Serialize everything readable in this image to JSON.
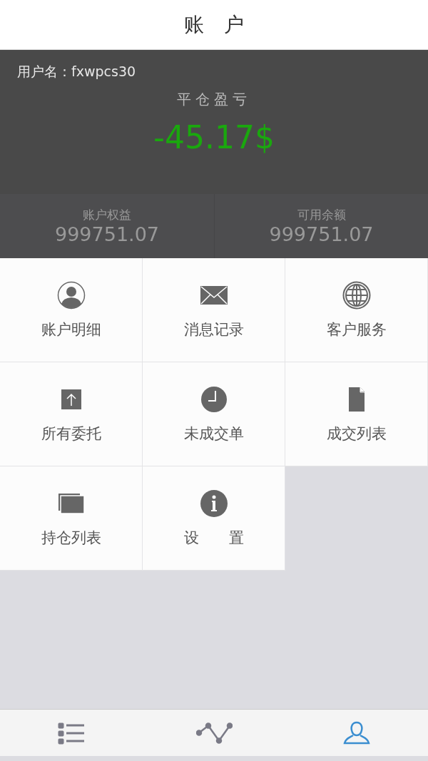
{
  "nav_bar": {
    "title": "账　户"
  },
  "summary": {
    "username_label": "用户名：",
    "username": "fxwpcs30",
    "pnl_label": "平仓盈亏",
    "pnl_value": "-45.17$"
  },
  "stats": [
    {
      "label": "账户权益",
      "value": "999751.07"
    },
    {
      "label": "可用余额",
      "value": "999751.07"
    }
  ],
  "menu": [
    {
      "label": "账户明细"
    },
    {
      "label": "消息记录"
    },
    {
      "label": "客户服务"
    },
    {
      "label": "所有委托"
    },
    {
      "label": "未成交单"
    },
    {
      "label": "成交列表"
    },
    {
      "label": "持仓列表"
    },
    {
      "label": "设　　置"
    }
  ],
  "tab_bar": [
    {
      "selected": false
    },
    {
      "selected": false
    },
    {
      "selected": true
    }
  ]
}
